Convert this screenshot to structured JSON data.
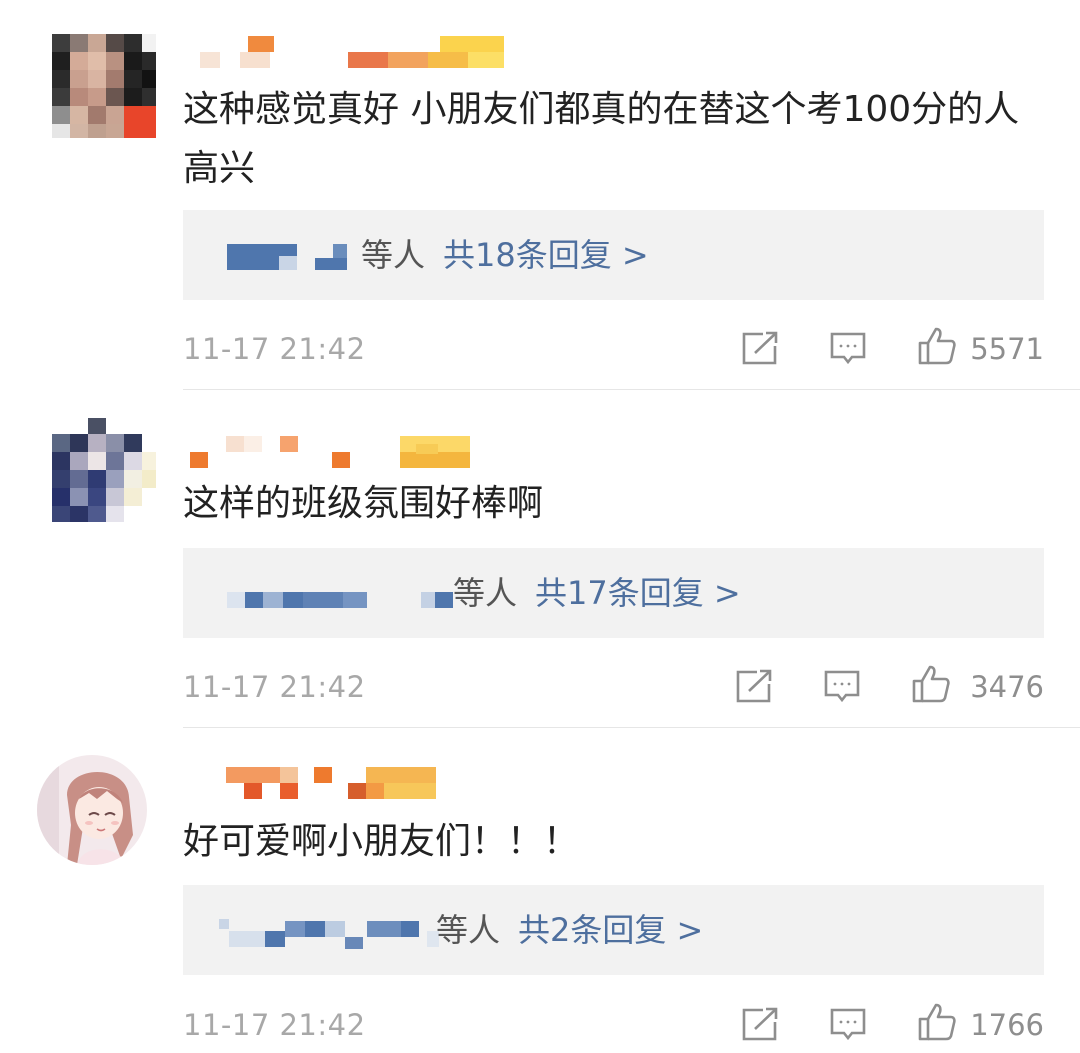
{
  "comments": [
    {
      "text": "这种感觉真好 小朋友们都真的在替这个考100分的人高兴",
      "reply_who": "等人",
      "reply_count": "共18条回复 >",
      "time": "11-17 21:42",
      "likes": "5571"
    },
    {
      "text": "这样的班级氛围好棒啊",
      "reply_who": "等人",
      "reply_count": "共17条回复 >",
      "time": "11-17 21:42",
      "likes": "3476"
    },
    {
      "text": "好可爱啊小朋友们！！！",
      "reply_who": "等人",
      "reply_count": "共2条回复 >",
      "time": "11-17 21:42",
      "likes": "1766"
    }
  ],
  "icons": {
    "repost": "share-icon",
    "comment": "comment-icon",
    "like": "thumbs-up-icon"
  },
  "colors": {
    "reply_link": "#4e6f9e",
    "reply_box": "#f2f2f2",
    "meta_text": "#a8a8a8"
  }
}
